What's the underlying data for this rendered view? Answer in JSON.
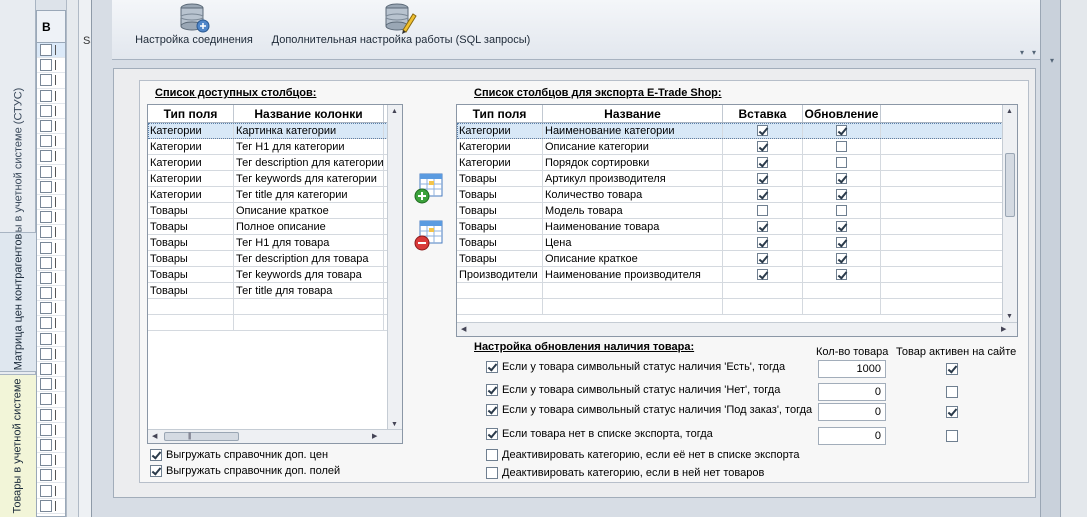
{
  "vertical_tabs": [
    "Товары в учетной системе (СТУС)",
    "Матрица цен контрагентов",
    "Товары в учетной системе"
  ],
  "grid_header": "В",
  "side_label": "Sa",
  "ribbon": {
    "connection_button": "Настройка соединения",
    "sql_button": "Дополнительная настройка работы (SQL запросы)"
  },
  "available": {
    "title": "Список доступных столбцов:",
    "headers": [
      "Тип поля",
      "Название колонки"
    ],
    "rows": [
      [
        "Категории",
        "Картинка категории"
      ],
      [
        "Категории",
        "Тег H1 для категории"
      ],
      [
        "Категории",
        "Тег description для категории"
      ],
      [
        "Категории",
        "Тег keywords для категории"
      ],
      [
        "Категории",
        "Тег title для категории"
      ],
      [
        "Товары",
        "Описание краткое"
      ],
      [
        "Товары",
        "Полное описание"
      ],
      [
        "Товары",
        "Тег H1 для товара"
      ],
      [
        "Товары",
        "Тег description для товара"
      ],
      [
        "Товары",
        "Тег keywords для товара"
      ],
      [
        "Товары",
        "Тег title для товара"
      ]
    ],
    "selected_row": 0
  },
  "export": {
    "title": "Список столбцов для экспорта E-Trade Shop:",
    "headers": [
      "Тип поля",
      "Название",
      "Вставка",
      "Обновление"
    ],
    "rows": [
      {
        "type": "Категории",
        "name": "Наименование категории",
        "insert": true,
        "update": true
      },
      {
        "type": "Категории",
        "name": "Описание категории",
        "insert": true,
        "update": false
      },
      {
        "type": "Категории",
        "name": "Порядок сортировки",
        "insert": true,
        "update": false
      },
      {
        "type": "Товары",
        "name": "Артикул производителя",
        "insert": true,
        "update": true
      },
      {
        "type": "Товары",
        "name": "Количество товара",
        "insert": true,
        "update": true
      },
      {
        "type": "Товары",
        "name": "Модель товара",
        "insert": false,
        "update": false
      },
      {
        "type": "Товары",
        "name": "Наименование товара",
        "insert": true,
        "update": true
      },
      {
        "type": "Товары",
        "name": "Цена",
        "insert": true,
        "update": true
      },
      {
        "type": "Товары",
        "name": "Описание краткое",
        "insert": true,
        "update": true
      },
      {
        "type": "Производители",
        "name": "Наименование производителя",
        "insert": true,
        "update": true
      }
    ],
    "selected_row": 0
  },
  "bottom_left_options": [
    {
      "label": "Выгружать справочник доп. цен",
      "checked": true
    },
    {
      "label": "Выгружать справочник доп. полей",
      "checked": true
    }
  ],
  "availability": {
    "title": "Настройка обновления наличия товара:",
    "col_qty": "Кол-во товара",
    "col_active": "Товар активен на сайте",
    "rows": [
      {
        "label": "Если у товара символьный статус наличия 'Есть', тогда",
        "checked": true,
        "qty": "1000",
        "active": true
      },
      {
        "label": "Если у товара символьный статус наличия 'Нет', тогда",
        "checked": true,
        "qty": "0",
        "active": false
      },
      {
        "label": "Если у товара символьный статус наличия 'Под заказ', тогда",
        "checked": true,
        "qty": "0",
        "active": true
      },
      {
        "label": "Если товара нет в списке экспорта, тогда",
        "checked": true,
        "qty": "0",
        "active": false
      }
    ],
    "extra_options": [
      {
        "label": "Деактивировать категорию, если её нет в списке экспорта",
        "checked": false
      },
      {
        "label": "Деактивировать категорию, если в ней нет товаров",
        "checked": false
      }
    ]
  }
}
